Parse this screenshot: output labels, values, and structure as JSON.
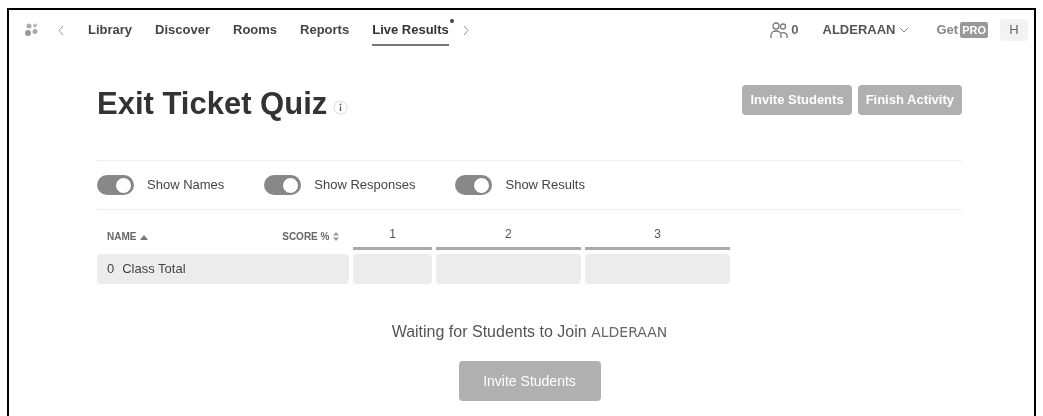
{
  "nav": {
    "tabs": [
      {
        "label": "Library",
        "selected": false
      },
      {
        "label": "Discover",
        "selected": false
      },
      {
        "label": "Rooms",
        "selected": false
      },
      {
        "label": "Reports",
        "selected": false
      },
      {
        "label": "Live Results",
        "selected": true,
        "badge_dot": true
      }
    ],
    "student_count": "0",
    "room": "ALDERAAN",
    "get_label": "Get",
    "pro_badge": "PRO",
    "avatar": "H"
  },
  "title": "Exit Ticket Quiz",
  "header_buttons": [
    "Invite Students",
    "Finish Activity"
  ],
  "toggles": [
    {
      "label": "Show Names",
      "on": true
    },
    {
      "label": "Show Responses",
      "on": true
    },
    {
      "label": "Show Results",
      "on": true
    }
  ],
  "table": {
    "columns": [
      {
        "label": "NAME",
        "sorted": true
      },
      {
        "label": "SCORE %",
        "sorted": false
      },
      {
        "label": "1"
      },
      {
        "label": "2"
      },
      {
        "label": "3"
      }
    ],
    "rows": [
      {
        "count": "0",
        "name": "Class Total"
      }
    ]
  },
  "waiting": {
    "text": "Waiting for Students to Join",
    "room": "ALDERAAN"
  },
  "invite_button": "Invite Students"
}
